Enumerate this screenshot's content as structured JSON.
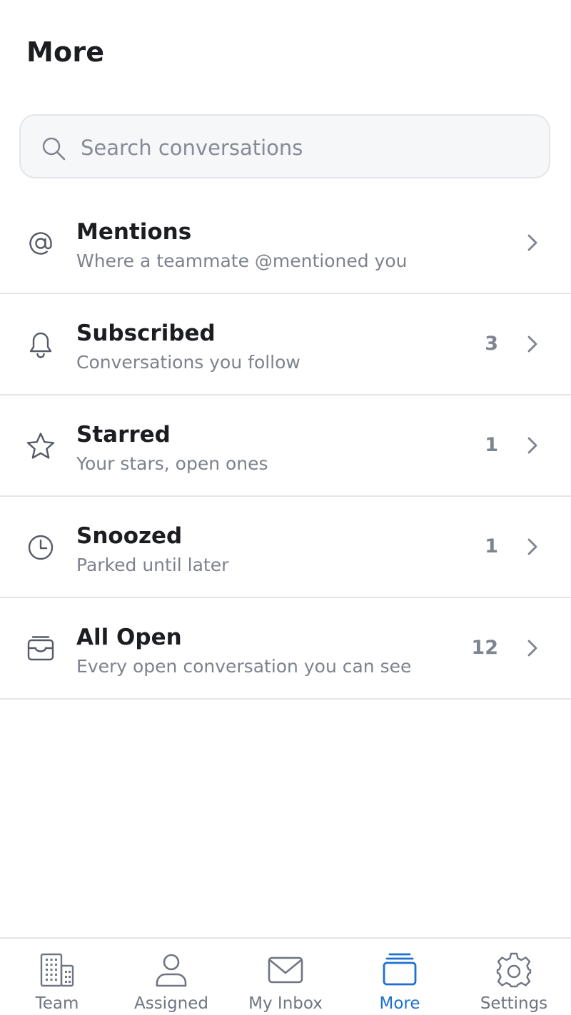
{
  "header": {
    "title": "More"
  },
  "search": {
    "placeholder": "Search conversations",
    "icon": "search-icon"
  },
  "items": [
    {
      "key": "mentions",
      "icon": "at-sign-icon",
      "title": "Mentions",
      "subtitle": "Where a teammate @mentioned you",
      "count": ""
    },
    {
      "key": "subscribed",
      "icon": "bell-icon",
      "title": "Subscribed",
      "subtitle": "Conversations you follow",
      "count": "3"
    },
    {
      "key": "starred",
      "icon": "star-icon",
      "title": "Starred",
      "subtitle": "Your stars, open ones",
      "count": "1"
    },
    {
      "key": "snoozed",
      "icon": "clock-icon",
      "title": "Snoozed",
      "subtitle": "Parked until later",
      "count": "1"
    },
    {
      "key": "all-open",
      "icon": "inbox-tray-icon",
      "title": "All Open",
      "subtitle": "Every open conversation you can see",
      "count": "12"
    }
  ],
  "tabs": [
    {
      "key": "team",
      "icon": "building-icon",
      "label": "Team",
      "active": false
    },
    {
      "key": "assigned",
      "icon": "user-icon",
      "label": "Assigned",
      "active": false
    },
    {
      "key": "my-inbox",
      "icon": "envelope-icon",
      "label": "My Inbox",
      "active": false
    },
    {
      "key": "more",
      "icon": "stack-icon",
      "label": "More",
      "active": true
    },
    {
      "key": "settings",
      "icon": "gear-icon",
      "label": "Settings",
      "active": false
    }
  ],
  "colors": {
    "accent": "#1f6fd1",
    "text_primary": "#1c1d21",
    "text_secondary": "#7d828d",
    "icon": "#555a66",
    "divider": "#e3e5e9",
    "search_bg": "#f6f7f9"
  }
}
